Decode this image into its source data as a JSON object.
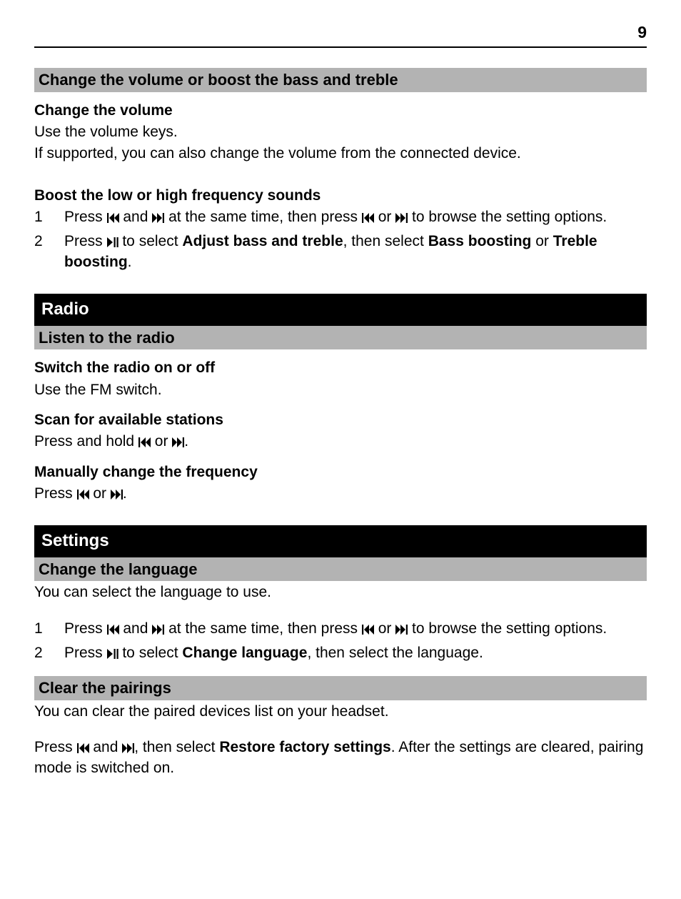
{
  "page_number": "9",
  "sec1": {
    "bar": "Change the volume or boost the bass and treble",
    "h1": "Change the volume",
    "p1": "Use the volume keys.",
    "p2": "If supported, you can also change the volume from the connected device.",
    "h2": "Boost the low or high frequency sounds",
    "s1a": "Press ",
    "s1b": " and ",
    "s1c": " at the same time, then press ",
    "s1d": " or ",
    "s1e": " to browse the setting options.",
    "s2a": "Press ",
    "s2b": " to select ",
    "s2c": "Adjust bass and treble",
    "s2d": ", then select ",
    "s2e": "Bass boosting",
    "s2f": " or ",
    "s2g": "Treble boosting",
    "s2h": "."
  },
  "radio": {
    "title": "Radio",
    "bar": "Listen to the radio",
    "h1": "Switch the radio on or off",
    "p1": "Use the FM switch.",
    "h2": "Scan for available stations",
    "p2a": "Press and hold ",
    "p2b": " or ",
    "p2c": ".",
    "h3": "Manually change the frequency",
    "p3a": "Press ",
    "p3b": " or ",
    "p3c": "."
  },
  "settings": {
    "title": "Settings",
    "bar1": "Change the language",
    "p1": "You can select the language to use.",
    "s1a": "Press ",
    "s1b": " and ",
    "s1c": " at the same time, then press ",
    "s1d": " or ",
    "s1e": " to browse the setting options.",
    "s2a": "Press ",
    "s2b": " to select ",
    "s2c": "Change language",
    "s2d": ", then select the language.",
    "bar2": "Clear the pairings",
    "p2": "You can clear the paired devices list on your headset.",
    "p3a": "Press ",
    "p3b": " and ",
    "p3c": ", then select ",
    "p3d": "Restore factory settings",
    "p3e": ". After the settings are cleared, pairing mode is switched on."
  },
  "nums": {
    "one": "1",
    "two": "2"
  }
}
